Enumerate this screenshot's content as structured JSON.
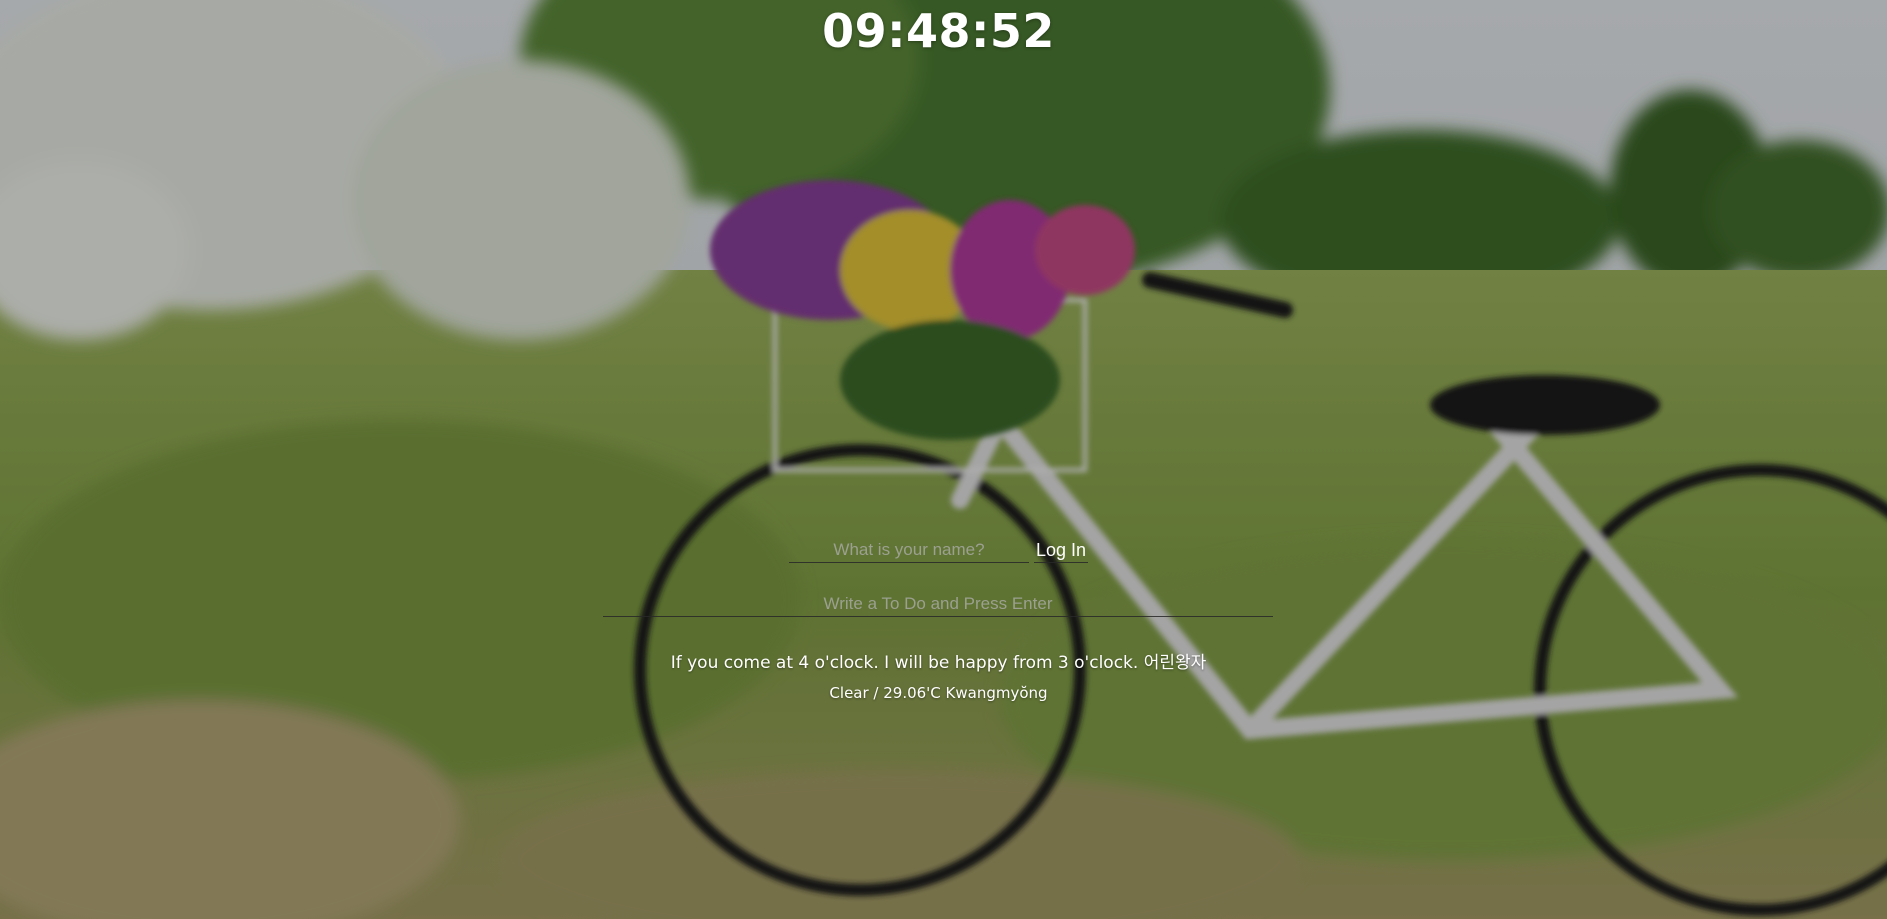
{
  "clock": {
    "time": "09:48:52"
  },
  "login": {
    "name_placeholder": "What is your name?",
    "button_label": "Log In"
  },
  "todo": {
    "placeholder": "Write a To Do and Press Enter"
  },
  "quote": {
    "text": "If you come at 4 o'clock. I will be happy from 3 o'clock. 어린왕자"
  },
  "weather": {
    "text": "Clear / 29.06'C Kwangmyŏng"
  },
  "background": {
    "description_colors": {
      "sky": "#d9dee2",
      "foliage": "#4d7a2e",
      "grass": "#8ea055",
      "blossom": "#eef1ea",
      "overlay": "rgba(0,0,0,0.3)"
    }
  }
}
